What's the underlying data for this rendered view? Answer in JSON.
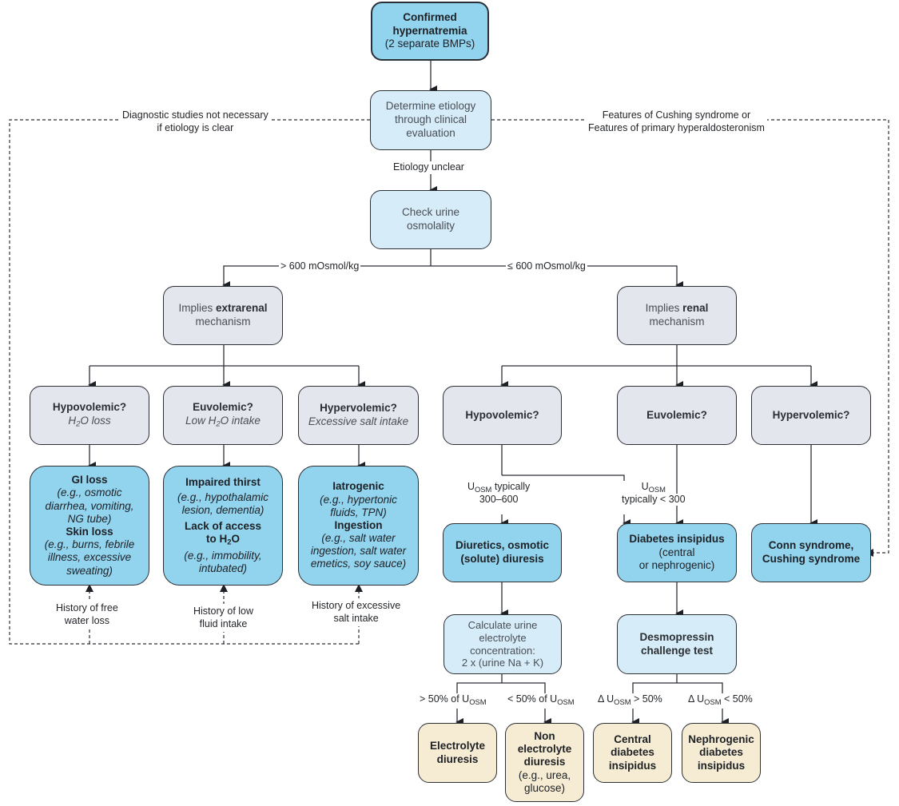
{
  "nodes": {
    "confirmed": {
      "title": "Confirmed hypernatremia",
      "line1": "Confirmed",
      "line2": "hypernatremia",
      "note": "(2 separate BMPs)"
    },
    "determine": {
      "line1": "Determine etiology",
      "line2": "through clinical",
      "line3": "evaluation"
    },
    "check_urine": {
      "line1": "Check urine",
      "line2": "osmolality"
    },
    "extrarenal": {
      "prefix": "Implies ",
      "emph": "extrarenal",
      "suffix": "mechanism"
    },
    "renal": {
      "prefix": "Implies ",
      "emph": "renal",
      "suffix": "mechanism"
    },
    "extra_hypo": {
      "title": "Hypovolemic?",
      "sub_pre": "H",
      "sub_num": "2",
      "sub_post": "O loss"
    },
    "extra_euvo": {
      "title": "Euvolemic?",
      "sub_pre": "Low H",
      "sub_num": "2",
      "sub_post": "O intake"
    },
    "extra_hyper": {
      "title": "Hypervolemic?",
      "sub": "Excessive salt intake"
    },
    "gi_skin": {
      "h1": "GI loss",
      "t1a": "(e.g., osmotic",
      "t1b": "diarrhea, vomiting,",
      "t1c": "NG tube)",
      "h2": "Skin loss",
      "t2a": "(e.g., burns, febrile",
      "t2b": "illness, excessive",
      "t2c": "sweating)"
    },
    "thirst": {
      "h1": "Impaired thirst",
      "t1a": "(e.g., hypothalamic",
      "t1b": "lesion, dementia)",
      "h2a": "Lack of access",
      "h2b_pre": "to H",
      "h2b_num": "2",
      "h2b_post": "O",
      "t2a": "(e.g., immobility,",
      "t2b": "intubated)"
    },
    "iatrogenic": {
      "h1": "Iatrogenic",
      "t1a": "(e.g., hypertonic",
      "t1b": "fluids, TPN)",
      "h2": "Ingestion",
      "t2a": "(e.g., salt water",
      "t2b": "ingestion, salt water",
      "t2c": "emetics, soy sauce)"
    },
    "renal_hypo": {
      "title": "Hypovolemic?"
    },
    "renal_euvo": {
      "title": "Euvolemic?"
    },
    "renal_hyper": {
      "title": "Hypervolemic?"
    },
    "diuretics": {
      "line1": "Diuretics, osmotic",
      "line2": "(solute) diuresis"
    },
    "di": {
      "title": "Diabetes insipidus",
      "line2": "(central",
      "line3": "or nephrogenic)"
    },
    "conn": {
      "line1": "Conn syndrome,",
      "line2": "Cushing syndrome"
    },
    "calc": {
      "line1": "Calculate urine",
      "line2": "electrolyte",
      "line3": "concentration:",
      "line4": "2 x (urine Na + K)"
    },
    "desmo": {
      "line1": "Desmopressin",
      "line2": "challenge test"
    },
    "electrolyte": {
      "line1": "Electrolyte",
      "line2": "diuresis"
    },
    "nonelectrolyte": {
      "line1": "Non",
      "line2": "electrolyte",
      "line3": "diuresis",
      "line4": "(e.g., urea,",
      "line5": "glucose)"
    },
    "central_di": {
      "line1": "Central",
      "line2": "diabetes",
      "line3": "insipidus"
    },
    "nephro_di": {
      "line1": "Nephrogenic",
      "line2": "diabetes",
      "line3": "insipidus"
    }
  },
  "edge_labels": {
    "diag_not_necessary_1": "Diagnostic studies not necessary",
    "diag_not_necessary_2": "if etiology is clear",
    "cushing_1": "Features of Cushing syndrome or",
    "cushing_2": "Features of primary hyperaldosteronism",
    "etiology_unclear": "Etiology unclear",
    "gt600": "> 600 mOsmol/kg",
    "le600": "≤ 600 mOsmol/kg",
    "hist_free_water_1": "History of free",
    "hist_free_water_2": "water loss",
    "hist_low_fluid_1": "History of low",
    "hist_low_fluid_2": "fluid intake",
    "hist_salt_1": "History of excessive",
    "hist_salt_2": "salt intake",
    "uosm_300_600_a": "U",
    "uosm_sub": "OSM",
    "uosm_300_600_b": " typically",
    "uosm_300_600_c": "300–600",
    "uosm_lt300_a": "U",
    "uosm_lt300_c": "typically < 300",
    "gt50_pre": "> 50% of U",
    "lt50_pre": "< 50% of U",
    "delta_gt_pre": "Δ U",
    "delta_gt_post": " > 50%",
    "delta_lt_pre": "Δ U",
    "delta_lt_post": " < 50%"
  },
  "colors": {
    "primary_blue": "#92d3ee",
    "light_blue": "#d6ecf8",
    "grey": "#e3e6ed",
    "tan": "#f6ecd3",
    "stroke": "#2b2f36"
  }
}
